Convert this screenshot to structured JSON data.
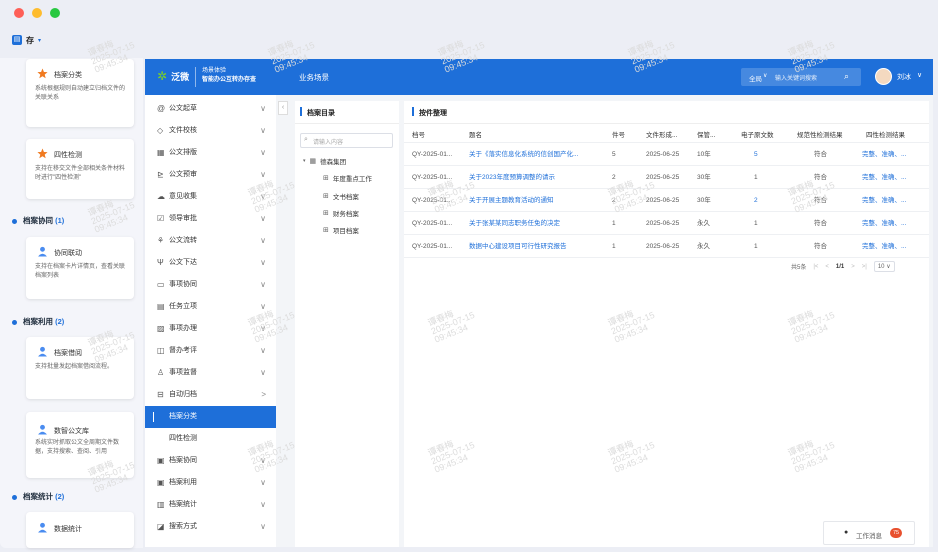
{
  "window": {
    "dots": [
      "#fe5f57",
      "#febc2e",
      "#28c840"
    ],
    "save_label": "存",
    "save_arrow": "▾"
  },
  "left_panel": {
    "cards": [
      {
        "title": "档案分类",
        "desc": "系统根据规则自动建立归档文件的关联关系",
        "icon": "star-icon"
      },
      {
        "title": "四性检测",
        "desc": "支持在移交文件全部相关条件材料时进行\"四性检测\"",
        "icon": "star-icon"
      },
      {
        "title": "协同联动",
        "desc": "支持在档案卡片详情页，查看关联档案列表",
        "icon": "user-icon"
      },
      {
        "title": "档案借阅",
        "desc": "支持批量发起档案借阅流程。",
        "icon": "user-icon"
      },
      {
        "title": "数智公文库",
        "desc": "系统实时抓取公文全周期文件数据，支持搜索、查阅、引用",
        "icon": "user-icon"
      },
      {
        "title": "数据统计",
        "desc": "",
        "icon": "user-icon"
      }
    ],
    "sections": [
      {
        "label": "档案协同",
        "count": "(1)"
      },
      {
        "label": "档案利用",
        "count": "(2)"
      },
      {
        "label": "档案统计",
        "count": "(2)"
      }
    ]
  },
  "watermark": {
    "name": "谭春梅",
    "date": "2025-07-15",
    "time": "09:45:34"
  },
  "app": {
    "logo_text": "泛微",
    "org_line1": "场景体验",
    "org_line2": "智能办公互转办存查",
    "nav_title": "业务场景",
    "search_scope": "全局",
    "search_placeholder": "输入关键词搜索",
    "user_name": "刘冰",
    "colors": {
      "primary": "#1e6fd9",
      "badge": "#e8502e"
    }
  },
  "menu": [
    {
      "icon": "edit-icon",
      "glyph": "@",
      "label": "公文起草",
      "chev": "∨"
    },
    {
      "icon": "doc-icon",
      "glyph": "◇",
      "label": "文件校核",
      "chev": "∨"
    },
    {
      "icon": "grid-icon",
      "glyph": "▦",
      "label": "公文排版",
      "chev": "∨"
    },
    {
      "icon": "chart-icon",
      "glyph": "⊵",
      "label": "公文预审",
      "chev": "∨"
    },
    {
      "icon": "cloud-icon",
      "glyph": "☁",
      "label": "意见收集",
      "chev": "∨"
    },
    {
      "icon": "check-icon",
      "glyph": "☑",
      "label": "领导审批",
      "chev": "∨"
    },
    {
      "icon": "flow-icon",
      "glyph": "⚘",
      "label": "公文流转",
      "chev": "∨"
    },
    {
      "icon": "send-icon",
      "glyph": "Ψ",
      "label": "公文下达",
      "chev": "∨"
    },
    {
      "icon": "monitor-icon",
      "glyph": "▭",
      "label": "事项协同",
      "chev": "∨"
    },
    {
      "icon": "task-icon",
      "glyph": "▤",
      "label": "任务立项",
      "chev": "∨"
    },
    {
      "icon": "handle-icon",
      "glyph": "▨",
      "label": "事项办理",
      "chev": "∨"
    },
    {
      "icon": "review-icon",
      "glyph": "◫",
      "label": "督办考评",
      "chev": "∨"
    },
    {
      "icon": "supervise-icon",
      "glyph": "♙",
      "label": "事项监督",
      "chev": "∨"
    },
    {
      "icon": "archive-icon",
      "glyph": "⊟",
      "label": "自动归档",
      "chev": ">"
    },
    {
      "icon": "",
      "glyph": "",
      "label": "档案分类",
      "chev": "",
      "active": true
    },
    {
      "icon": "",
      "glyph": "",
      "label": "四性检测",
      "chev": ""
    },
    {
      "icon": "collab-icon",
      "glyph": "▣",
      "label": "档案协同",
      "chev": "∨"
    },
    {
      "icon": "use-icon",
      "glyph": "▣",
      "label": "档案利用",
      "chev": "∨"
    },
    {
      "icon": "stats-icon",
      "glyph": "▥",
      "label": "档案统计",
      "chev": "∨"
    },
    {
      "icon": "search-mode-icon",
      "glyph": "◪",
      "label": "搜索方式",
      "chev": "∨"
    }
  ],
  "tree": {
    "title": "档案目录",
    "search_placeholder": "请输入内容",
    "root": "德森集团",
    "children": [
      "年度重点工作",
      "文书档案",
      "财务档案",
      "项目档案"
    ]
  },
  "table": {
    "title": "按件整理",
    "headers": [
      "档号",
      "题名",
      "件号",
      "文件形成...",
      "保管...",
      "电子原文数",
      "规范性检测结果",
      "四性检测结果"
    ],
    "rows": [
      [
        "QY-2025-01...",
        "关于《落实信息化系统的信创国产化...",
        "5",
        "2025-06-25",
        "10年",
        "5",
        "符合",
        "完整、准确、..."
      ],
      [
        "QY-2025-01...",
        "关于2023年度预算调整的请示",
        "2",
        "2025-06-25",
        "30年",
        "1",
        "符合",
        "完整、准确、..."
      ],
      [
        "QY-2025-01...",
        "关于开展主题教育活动的通知",
        "2",
        "2025-06-25",
        "30年",
        "2",
        "符合",
        "完整、准确、..."
      ],
      [
        "QY-2025-01...",
        "关于张某某同志职务任免的决定",
        "1",
        "2025-06-25",
        "永久",
        "1",
        "符合",
        "完整、准确、..."
      ],
      [
        "QY-2025-01...",
        "数据中心建设项目可行性研究报告",
        "1",
        "2025-06-25",
        "永久",
        "1",
        "符合",
        "完整、准确、..."
      ]
    ],
    "pager": {
      "total": "共5条",
      "page": "1/1",
      "size": "10"
    }
  },
  "work_msg": {
    "label": "工作消息",
    "count": "75"
  }
}
